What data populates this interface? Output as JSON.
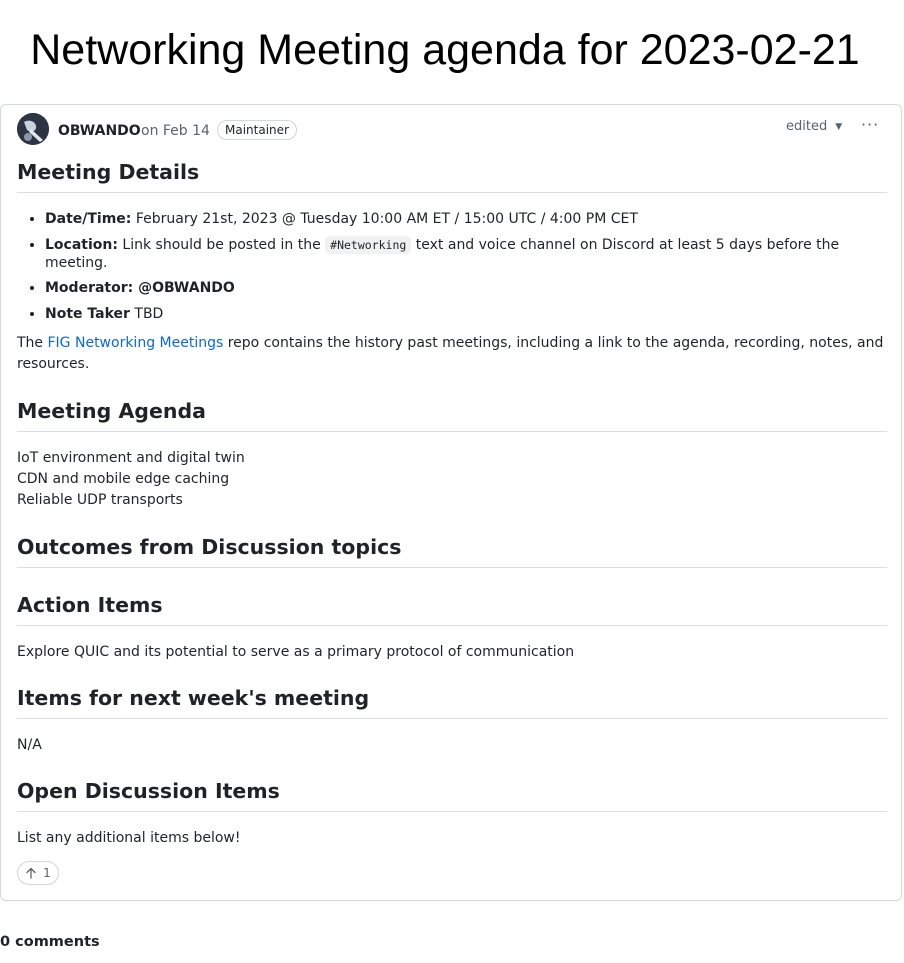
{
  "page": {
    "title": "Networking Meeting agenda for 2023-02-21"
  },
  "post": {
    "author": "OBWANDO",
    "date": "on Feb 14",
    "badge": "Maintainer",
    "edited_label": "edited",
    "more_icon": "kebab-horizontal-icon"
  },
  "content": {
    "details_heading": "Meeting Details",
    "details": {
      "datetime_label": "Date/Time:",
      "datetime_value": " February 21st, 2023 @ Tuesday 10:00 AM ET / 15:00 UTC / 4:00 PM CET",
      "location_label": "Location:",
      "location_pre": " Link should be posted in the ",
      "location_code": "#Networking",
      "location_post": " text and voice channel on Discord at least 5 days before the meeting.",
      "moderator_label": "Moderator:",
      "moderator_value": " @OBWANDO",
      "notetaker_label": "Note Taker",
      "notetaker_value": " TBD"
    },
    "repo_pre": "The ",
    "repo_link": "FIG Networking Meetings",
    "repo_post": " repo contains the history past meetings, including a link to the agenda, recording, notes, and resources.",
    "agenda_heading": "Meeting Agenda",
    "agenda_items": [
      "IoT environment and digital twin",
      "CDN and mobile edge caching",
      "Reliable UDP transports"
    ],
    "outcomes_heading": "Outcomes from Discussion topics",
    "action_heading": "Action Items",
    "action_text": "Explore QUIC and its potential to serve as a primary protocol of communication",
    "next_heading": "Items for next week's meeting",
    "next_text": "N/A",
    "open_heading": "Open Discussion Items",
    "open_text": "List any additional items below!"
  },
  "reaction": {
    "icon": "arrow-up-icon",
    "count": "1"
  },
  "footer": {
    "comments": "0 comments"
  },
  "colors": {
    "link": "#0969da",
    "border": "#d0d7de",
    "muted": "#59636e"
  }
}
